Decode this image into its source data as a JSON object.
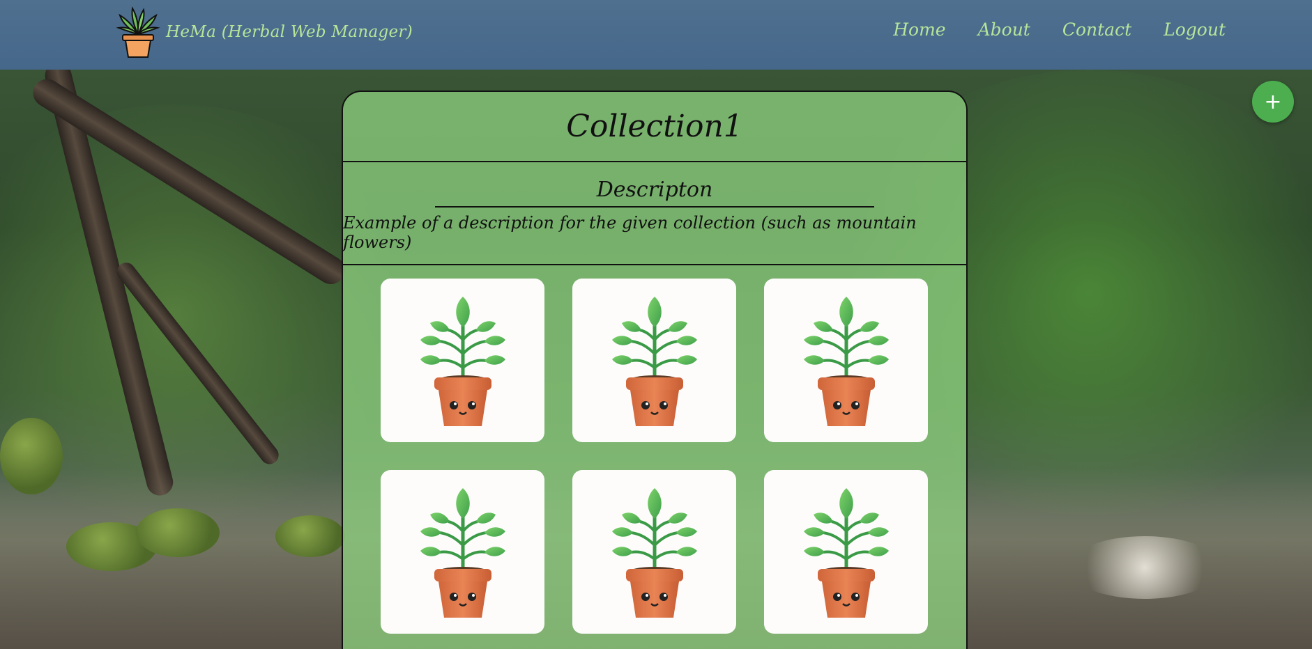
{
  "header": {
    "brand_name": "HeMa (Herbal Web Manager)",
    "logo_icon": "potted-plant-logo-icon",
    "nav": [
      {
        "label": "Home"
      },
      {
        "label": "About"
      },
      {
        "label": "Contact"
      },
      {
        "label": "Logout"
      }
    ]
  },
  "add_button": {
    "label": "+",
    "icon": "plus-icon"
  },
  "collection": {
    "title": "Collection1",
    "description_heading": "Descripton",
    "description_text": "Example of a description for the given collection (such as mountain flowers)",
    "plants": [
      {
        "icon": "potted-plant-icon"
      },
      {
        "icon": "potted-plant-icon"
      },
      {
        "icon": "potted-plant-icon"
      },
      {
        "icon": "potted-plant-icon"
      },
      {
        "icon": "potted-plant-icon"
      },
      {
        "icon": "potted-plant-icon"
      }
    ]
  },
  "colors": {
    "header_bg": "#4a6b8c",
    "nav_text": "#b6e59a",
    "panel_bg": "#8ccd7d",
    "fab_bg": "#4cae4f",
    "pot": "#e07a4a",
    "leaf": "#4cae4f"
  }
}
